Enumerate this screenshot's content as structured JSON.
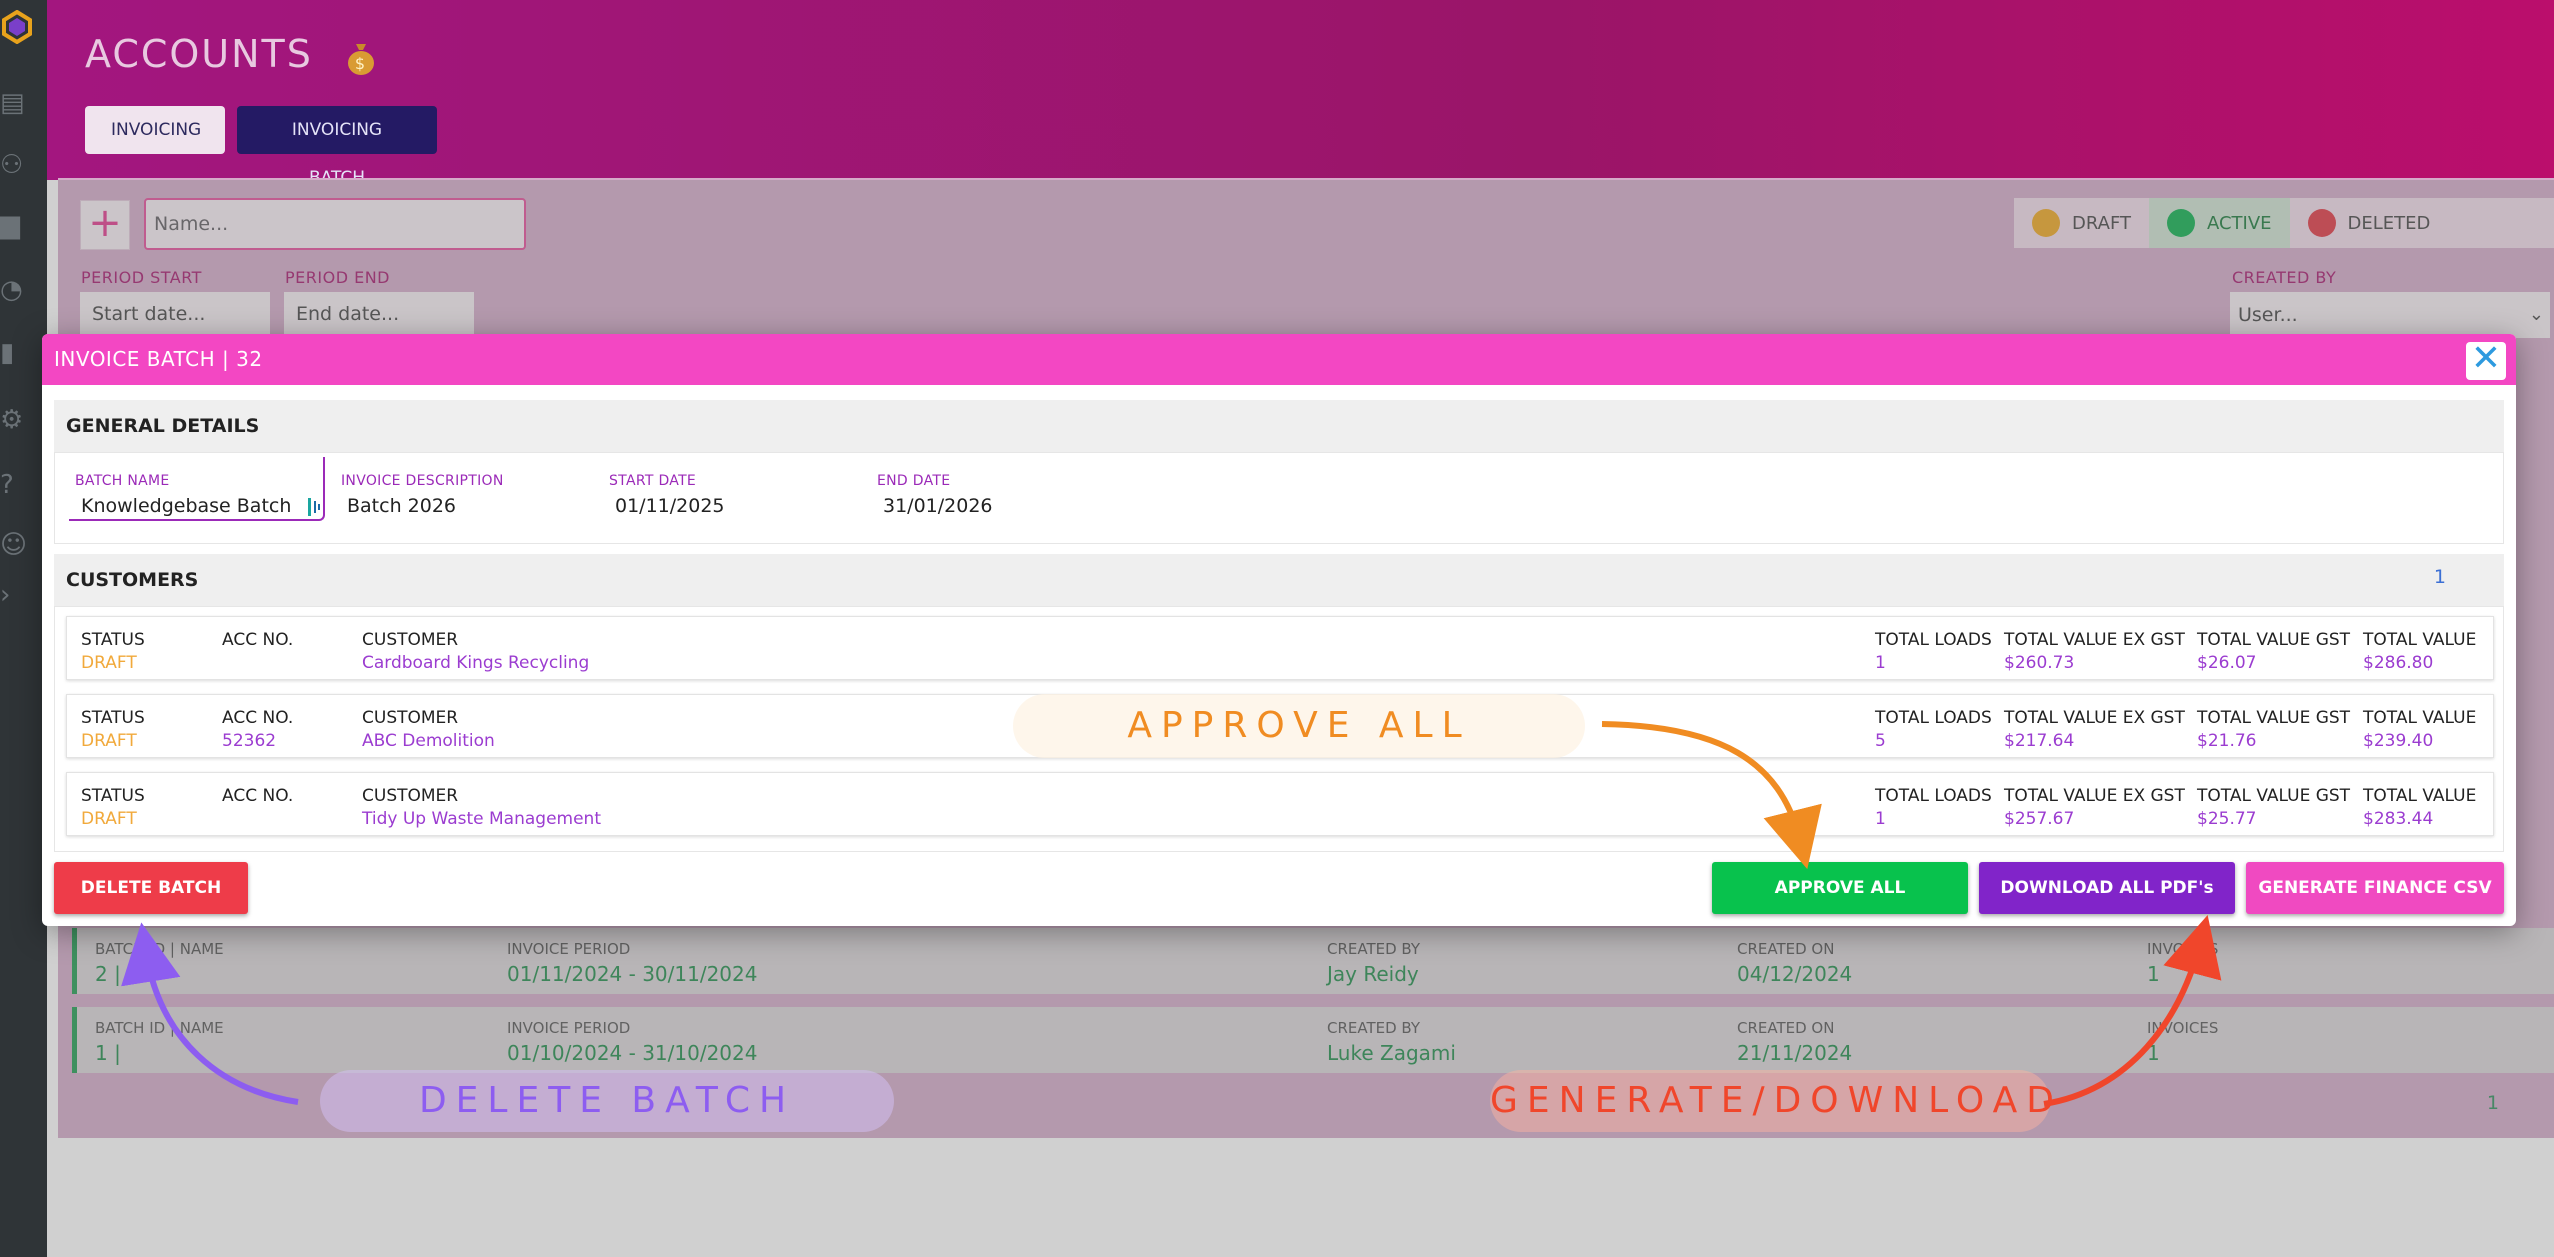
{
  "header": {
    "title": "ACCOUNTS",
    "tabs": [
      {
        "label": "INVOICING"
      },
      {
        "label": "INVOICING BATCH"
      }
    ]
  },
  "filters": {
    "name_placeholder": "Name...",
    "period_start_label": "PERIOD START",
    "period_start_placeholder": "Start date...",
    "period_end_label": "PERIOD END",
    "period_end_placeholder": "End date...",
    "statuses": [
      {
        "label": "DRAFT",
        "color": "#f0a81f"
      },
      {
        "label": "ACTIVE",
        "color": "#0bb14e"
      },
      {
        "label": "DELETED",
        "color": "#e23743"
      }
    ],
    "created_by_label": "CREATED BY",
    "created_by_placeholder": "User..."
  },
  "batch_rows": [
    {
      "id_label": "BATCH ID | NAME",
      "id_value": "2 |",
      "period_label": "INVOICE PERIOD",
      "period_value": "01/11/2024 - 30/11/2024",
      "created_by_label": "CREATED BY",
      "created_by_value": "Jay Reidy",
      "created_on_label": "CREATED ON",
      "created_on_value": "04/12/2024",
      "invoices_label": "INVOICES",
      "invoices_value": "1"
    },
    {
      "id_label": "BATCH ID | NAME",
      "id_value": "1 |",
      "period_label": "INVOICE PERIOD",
      "period_value": "01/10/2024 - 31/10/2024",
      "created_by_label": "CREATED BY",
      "created_by_value": "Luke Zagami",
      "created_on_label": "CREATED ON",
      "created_on_value": "21/11/2024",
      "invoices_label": "INVOICES",
      "invoices_value": "1"
    }
  ],
  "batch_pager": "1",
  "modal": {
    "title": "INVOICE BATCH | 32",
    "general": {
      "heading": "GENERAL DETAILS",
      "batch_name_label": "BATCH NAME",
      "batch_name_value": "Knowledgebase Batch",
      "description_label": "INVOICE DESCRIPTION",
      "description_value": "Batch 2026",
      "start_label": "START DATE",
      "start_value": "01/11/2025",
      "end_label": "END DATE",
      "end_value": "31/01/2026"
    },
    "customers": {
      "heading": "CUSTOMERS",
      "count": "1",
      "columns": {
        "status": "STATUS",
        "acc": "ACC NO.",
        "customer": "CUSTOMER",
        "loads": "TOTAL LOADS",
        "ex_gst": "TOTAL VALUE EX GST",
        "gst": "TOTAL VALUE GST",
        "total": "TOTAL VALUE"
      },
      "rows": [
        {
          "status": "DRAFT",
          "acc": "",
          "customer": "Cardboard Kings Recycling",
          "loads": "1",
          "ex_gst": "$260.73",
          "gst": "$26.07",
          "total": "$286.80"
        },
        {
          "status": "DRAFT",
          "acc": "52362",
          "customer": "ABC Demolition",
          "loads": "5",
          "ex_gst": "$217.64",
          "gst": "$21.76",
          "total": "$239.40"
        },
        {
          "status": "DRAFT",
          "acc": "",
          "customer": "Tidy Up Waste Management",
          "loads": "1",
          "ex_gst": "$257.67",
          "gst": "$25.77",
          "total": "$283.44"
        }
      ]
    },
    "buttons": {
      "delete": "DELETE BATCH",
      "approve": "APPROVE ALL",
      "download": "DOWNLOAD ALL PDF's",
      "csv": "GENERATE FINANCE CSV"
    }
  },
  "annotations": {
    "approve": "APPROVE ALL",
    "delete": "DELETE BATCH",
    "generate": "GENERATE/DOWNLOAD"
  },
  "colors": {
    "header_magenta": "#a3167f",
    "modal_header": "#f347c3",
    "approve_green": "#08c24d",
    "download_purple": "#8124c9",
    "delete_red": "#ee3c49"
  }
}
